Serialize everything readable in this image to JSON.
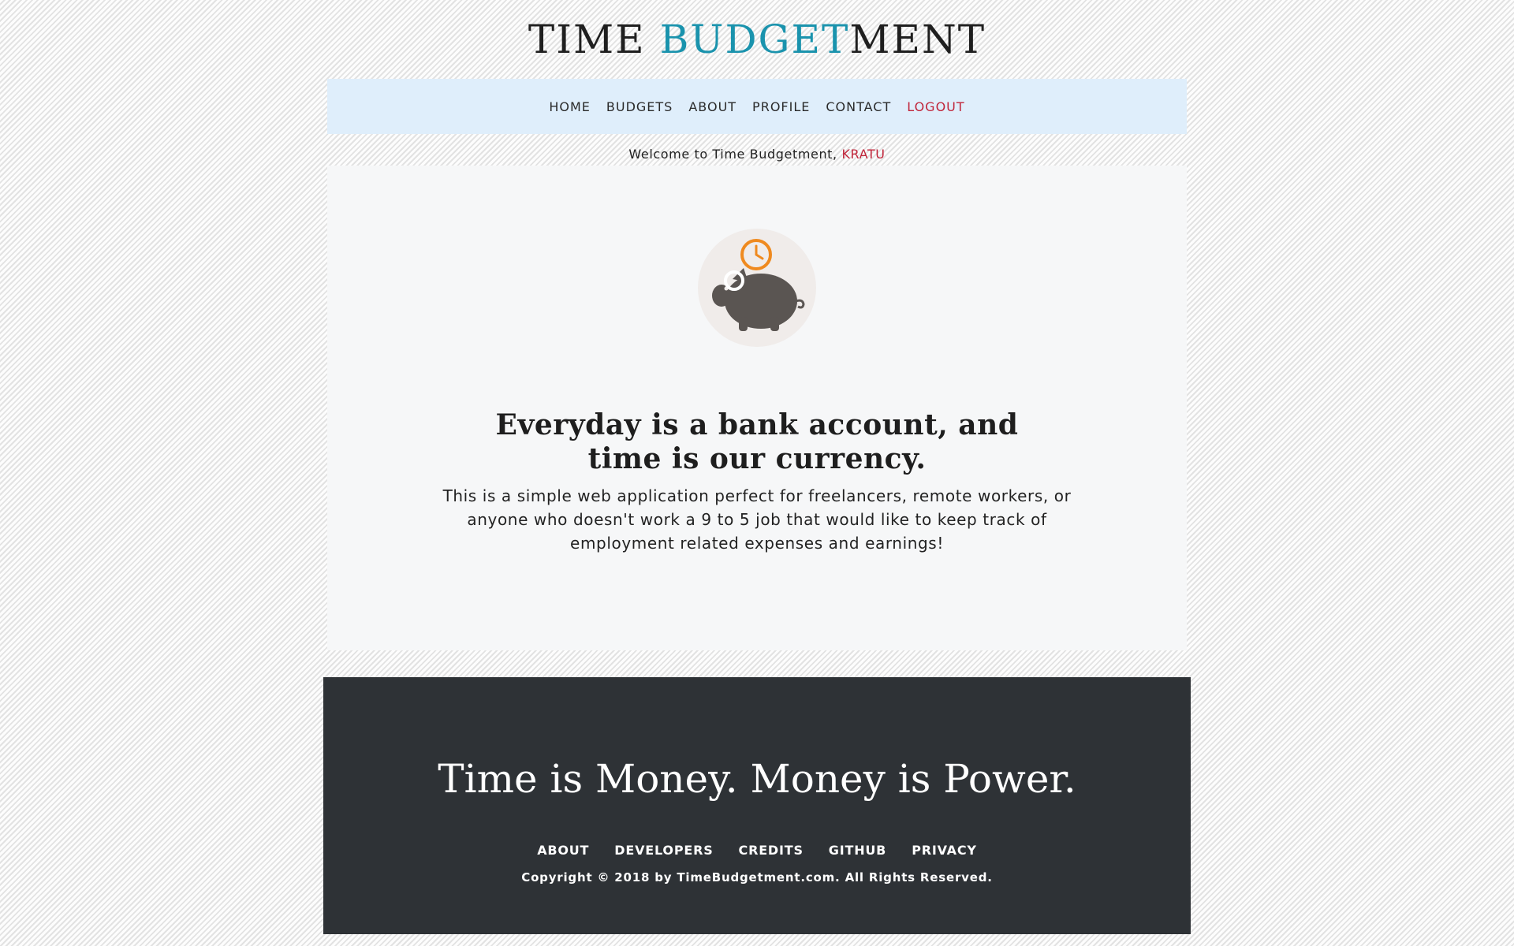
{
  "header": {
    "logo_part1": "TIME ",
    "logo_accent": "BUDGET",
    "logo_part2": "MENT",
    "accent_color": "#1a93ad"
  },
  "nav": {
    "items": [
      {
        "label": "HOME"
      },
      {
        "label": "BUDGETS"
      },
      {
        "label": "ABOUT"
      },
      {
        "label": "PROFILE"
      },
      {
        "label": "CONTACT"
      },
      {
        "label": "LOGOUT",
        "color": "#c0253a"
      }
    ],
    "background": "#dfeefb"
  },
  "welcome": {
    "prefix": "Welcome to Time Budgetment, ",
    "username": "KRATU"
  },
  "hero": {
    "icon": "piggy-bank-clock-icon",
    "headline_line1": "Everyday is a bank account, and",
    "headline_line2": "time is our currency.",
    "description": "This is a simple web application perfect for freelancers, remote workers, or anyone who doesn't work a 9 to 5 job that would like to keep track of employment related expenses and earnings!"
  },
  "footer": {
    "tagline": "Time is Money. Money is Power.",
    "links": [
      {
        "label": "ABOUT"
      },
      {
        "label": "DEVELOPERS"
      },
      {
        "label": "CREDITS"
      },
      {
        "label": "GITHUB"
      },
      {
        "label": "PRIVACY"
      }
    ],
    "copyright": "Copyright © 2018 by TimeBudgetment.com. All Rights Reserved.",
    "background": "#2e3236"
  }
}
